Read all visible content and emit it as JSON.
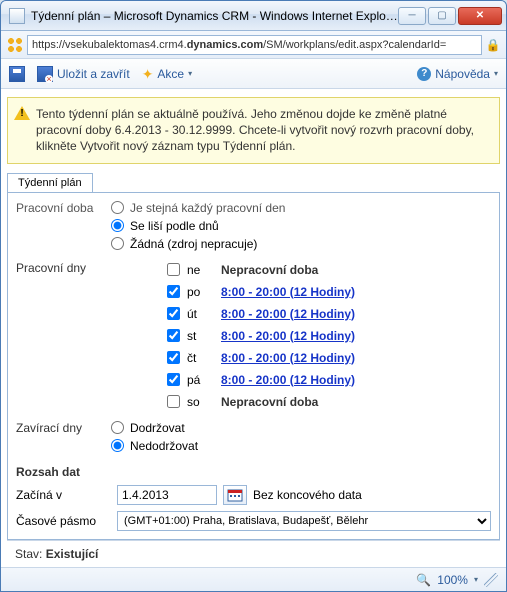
{
  "window": {
    "title": "Týdenní plán – Microsoft Dynamics CRM - Windows Internet Explor..."
  },
  "address": {
    "prefix": "https://vsekubalektomas4.crm4.",
    "bold": "dynamics.com",
    "suffix": "/SM/workplans/edit.aspx?calendarId="
  },
  "toolbar": {
    "save_close": "Uložit a zavřít",
    "actions": "Akce",
    "help": "Nápověda"
  },
  "warning": "Tento týdenní plán se aktuálně používá. Jeho změnou dojde ke změně platné pracovní doby 6.4.2013 - 30.12.9999. Chcete-li vytvořit nový rozvrh pracovní doby, klikněte Vytvořit nový záznam typu Týdenní plán.",
  "tab": {
    "label": "Týdenní plán"
  },
  "form": {
    "workhours_label": "Pracovní doba",
    "opt_same": "Je stejná každý pracovní den",
    "opt_diff": "Se liší podle dnů",
    "opt_none": "Žádná (zdroj nepracuje)",
    "workdays_label": "Pracovní dny",
    "closing_label": "Zavírací dny",
    "closing_observe": "Dodržovat",
    "closing_notobserve": "Nedodržovat",
    "range_title": "Rozsah dat",
    "starts_label": "Začíná v",
    "starts_value": "1.4.2013",
    "noend": "Bez koncového data",
    "tz_label": "Časové pásmo",
    "tz_value": "(GMT+01:00) Praha, Bratislava, Budapešť, Bělehr"
  },
  "days": [
    {
      "abbr": "ne",
      "checked": false,
      "link": false,
      "text": "Nepracovní doba"
    },
    {
      "abbr": "po",
      "checked": true,
      "link": true,
      "text": "8:00 - 20:00 (12 Hodiny)"
    },
    {
      "abbr": "út",
      "checked": true,
      "link": true,
      "text": "8:00 - 20:00 (12 Hodiny)"
    },
    {
      "abbr": "st",
      "checked": true,
      "link": true,
      "text": "8:00 - 20:00 (12 Hodiny)"
    },
    {
      "abbr": "čt",
      "checked": true,
      "link": true,
      "text": "8:00 - 20:00 (12 Hodiny)"
    },
    {
      "abbr": "pá",
      "checked": true,
      "link": true,
      "text": "8:00 - 20:00 (12 Hodiny)"
    },
    {
      "abbr": "so",
      "checked": false,
      "link": false,
      "text": "Nepracovní doba"
    }
  ],
  "status": {
    "label": "Stav: ",
    "value": "Existující"
  },
  "ie": {
    "zoom": "100%"
  }
}
